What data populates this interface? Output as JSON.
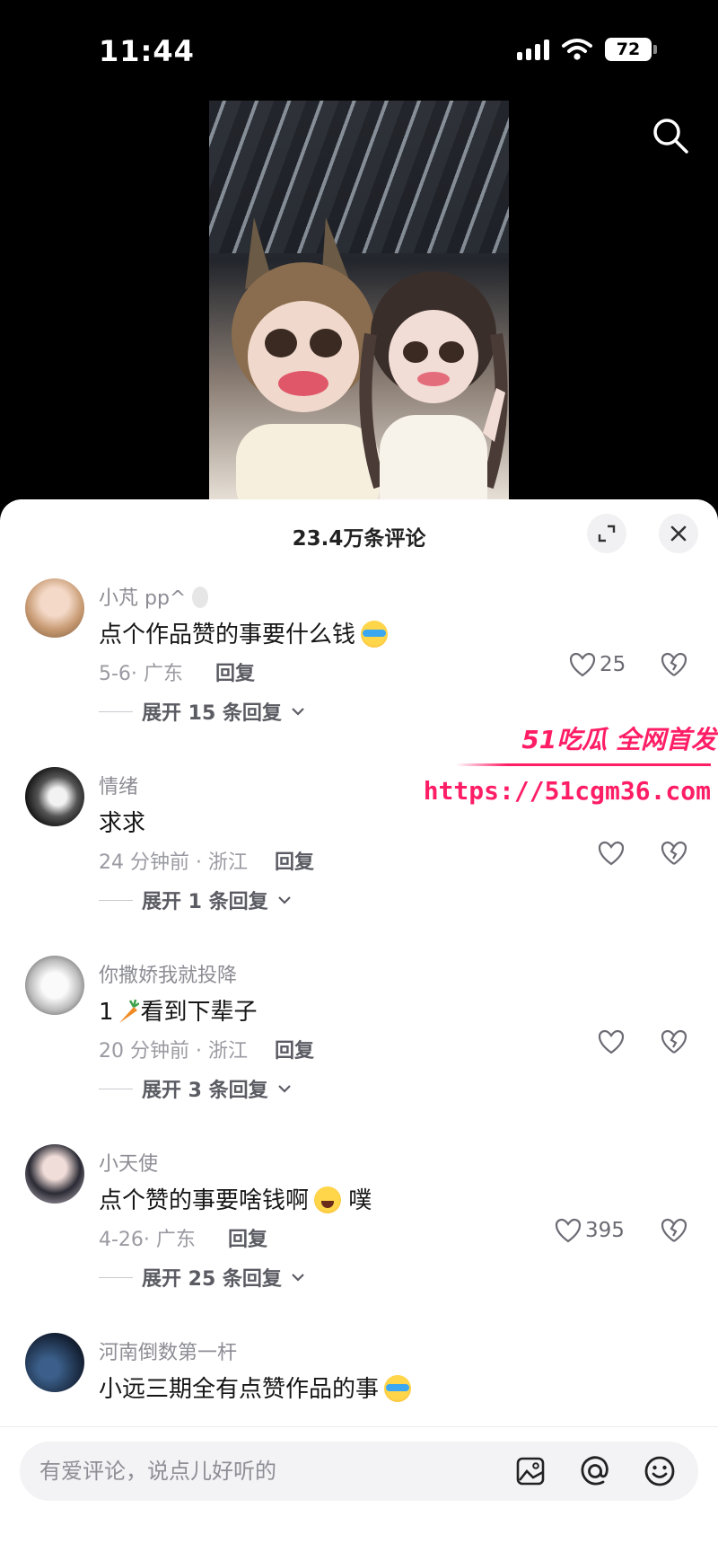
{
  "status": {
    "time": "11:44",
    "battery": "72"
  },
  "header": {
    "search_icon": "search-icon"
  },
  "panel": {
    "title": "23.4万条评论",
    "expand_icon": "expand-icon",
    "close_icon": "close-icon"
  },
  "comments": [
    {
      "user": "小芃 pp^",
      "text": "点个作品赞的事要什么钱",
      "emoji": "crying-laughing-emoji",
      "meta": "5-6· 广东",
      "reply": "回复",
      "likes": "25",
      "expand": "展开 15 条回复"
    },
    {
      "user": "情绪",
      "text": "求求",
      "meta": "24 分钟前 · 浙江",
      "reply": "回复",
      "likes": "",
      "expand": "展开 1 条回复"
    },
    {
      "user": "你撒娇我就投降",
      "text_prefix": "1",
      "text": "看到下辈子",
      "emoji": "carrot-emoji",
      "meta": "20 分钟前 · 浙江",
      "reply": "回复",
      "likes": "",
      "expand": "展开 3 条回复"
    },
    {
      "user": "小天使",
      "text": "点个赞的事要啥钱啊",
      "text_suffix": "噗",
      "emoji": "tears-of-joy-emoji",
      "meta": "4-26· 广东",
      "reply": "回复",
      "likes": "395",
      "expand": "展开 25 条回复"
    },
    {
      "user": "河南倒数第一杆",
      "text": "小远三期全有点赞作品的事",
      "emoji": "crying-laughing-emoji"
    }
  ],
  "watermark": {
    "brand": "51吃瓜 全网首发",
    "url": "https://51cgm36.com"
  },
  "input": {
    "placeholder": "有爱评论，说点儿好听的"
  },
  "toolbar": {
    "image_icon": "image-icon",
    "mention_icon": "at-mention-icon",
    "emoji_icon": "emoji-icon"
  }
}
